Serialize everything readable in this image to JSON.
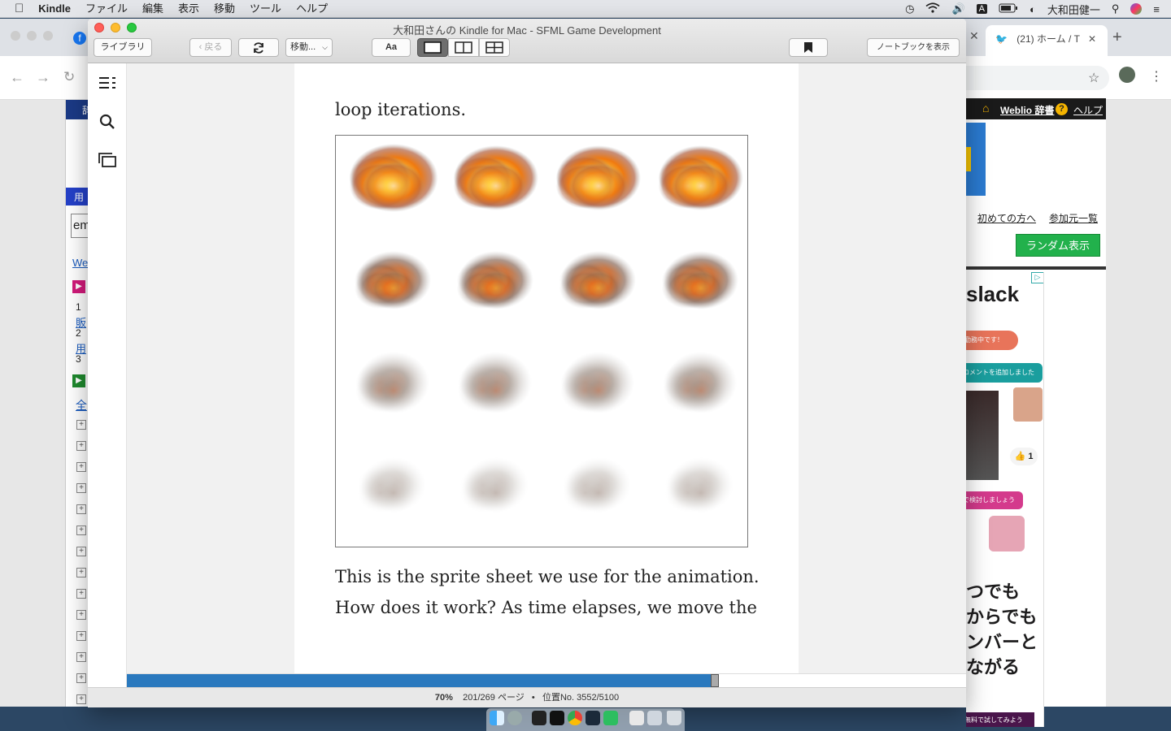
{
  "menubar": {
    "apple": "",
    "app_name": "Kindle",
    "items": [
      "ファイル",
      "編集",
      "表示",
      "移動",
      "ツール",
      "ヘルプ"
    ],
    "input_indicator": "A",
    "user_name": "大和田健一"
  },
  "browser": {
    "tab_label": "(21) ホーム / T",
    "weblio": {
      "logo": "Weblio 辞書",
      "help": "ヘルプ",
      "link_first_time": "初めての方へ",
      "link_participants": "参加元一覧",
      "random_button": "ランダム表示",
      "search_value": "em",
      "left_link": "We",
      "left_numbers": [
        "1",
        "2",
        "3"
      ],
      "left_chars": [
        "販",
        "用",
        "全",
        "用"
      ],
      "tab_fragment": "辞"
    },
    "ad": {
      "brand": "slack",
      "bubbles": [
        "勤務中です！",
        "コメントを追加しました",
        "で検討しましょう",
        "無料で試してみよう"
      ],
      "like_count": "1",
      "headline_lines": [
        "つでも",
        "からでも",
        "ンバーと",
        "ながる"
      ]
    }
  },
  "kindle": {
    "window_title": "大和田さんの Kindle for Mac - SFML Game Development",
    "toolbar": {
      "library": "ライブラリ",
      "back": "戻る",
      "goto": "移動...",
      "font": "Aa",
      "notebook": "ノートブックを表示"
    },
    "page": {
      "top_line": "loop iterations.",
      "body_lines": [
        "This is the sprite sheet we use for the animation.",
        "How does it work? As time elapses, we move the"
      ]
    },
    "status": {
      "percent": "70%",
      "pages": "201/269 ページ",
      "separator": "•",
      "location": "位置No. 3552/5100"
    },
    "progress": 0.7
  },
  "colors": {
    "progress_blue": "#2a79be",
    "traffic_red": "#ff5f57",
    "traffic_yellow": "#febc2e",
    "traffic_green": "#28c840",
    "weblio_green": "#22b14c"
  }
}
